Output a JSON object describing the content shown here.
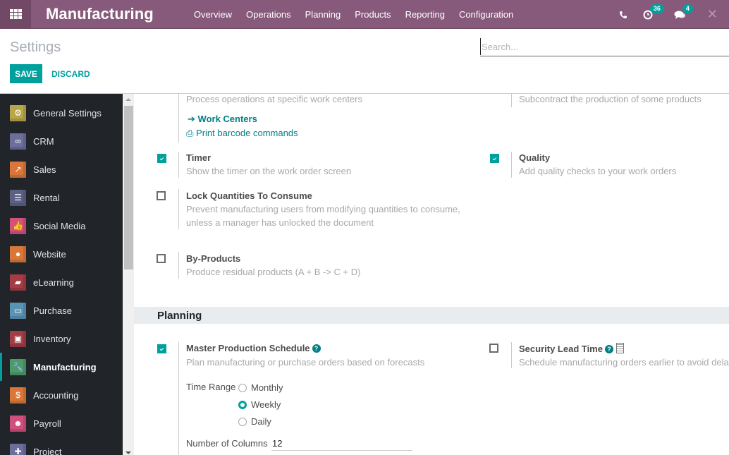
{
  "navbar": {
    "app_title": "Manufacturing",
    "menu": [
      "Overview",
      "Operations",
      "Planning",
      "Products",
      "Reporting",
      "Configuration"
    ],
    "activity_count": "36",
    "message_count": "4"
  },
  "control_panel": {
    "title": "Settings",
    "search_placeholder": "Search...",
    "save_label": "SAVE",
    "discard_label": "DISCARD"
  },
  "sidebar": {
    "active": "Manufacturing",
    "items": [
      {
        "label": "General Settings",
        "icon": "gear-icon",
        "color": "#b8a74a"
      },
      {
        "label": "CRM",
        "icon": "handshake-icon",
        "color": "#6c6e9c"
      },
      {
        "label": "Sales",
        "icon": "chart-icon",
        "color": "#d9773a"
      },
      {
        "label": "Rental",
        "icon": "calendar-icon",
        "color": "#5c6184"
      },
      {
        "label": "Social Media",
        "icon": "thumbs-up-icon",
        "color": "#d2537a"
      },
      {
        "label": "Website",
        "icon": "globe-icon",
        "color": "#d9773a"
      },
      {
        "label": "eLearning",
        "icon": "presentation-icon",
        "color": "#a33c45"
      },
      {
        "label": "Purchase",
        "icon": "credit-card-icon",
        "color": "#5b93b5"
      },
      {
        "label": "Inventory",
        "icon": "box-icon",
        "color": "#a33c45"
      },
      {
        "label": "Manufacturing",
        "icon": "wrench-icon",
        "color": "#4d9a6b"
      },
      {
        "label": "Accounting",
        "icon": "invoice-icon",
        "color": "#d9773a"
      },
      {
        "label": "Payroll",
        "icon": "payroll-icon",
        "color": "#cf4f7d"
      },
      {
        "label": "Project",
        "icon": "puzzle-icon",
        "color": "#6c6e9c"
      }
    ]
  },
  "operations": {
    "workorders_desc": "Process operations at specific work centers",
    "work_centers_link": "Work Centers",
    "print_barcode_link": "Print barcode commands",
    "subcontracting_desc": "Subcontract the production of some products",
    "timer": {
      "title": "Timer",
      "desc": "Show the timer on the work order screen",
      "checked": true
    },
    "quality": {
      "title": "Quality",
      "desc": "Add quality checks to your work orders",
      "checked": true
    },
    "lock_quantities": {
      "title": "Lock Quantities To Consume",
      "desc_line1": "Prevent manufacturing users from modifying quantities to consume,",
      "desc_line2": "unless a manager has unlocked the document",
      "checked": false
    },
    "by_products": {
      "title": "By-Products",
      "desc": "Produce residual products (A + B -> C + D)",
      "checked": false
    }
  },
  "planning": {
    "section_title": "Planning",
    "mps": {
      "title": "Master Production Schedule",
      "desc": "Plan manufacturing or purchase orders based on forecasts",
      "checked": true
    },
    "security_lead_time": {
      "title": "Security Lead Time",
      "desc": "Schedule manufacturing orders earlier to avoid delays",
      "checked": false
    },
    "time_range_label": "Time Range",
    "time_range_options": [
      "Monthly",
      "Weekly",
      "Daily"
    ],
    "time_range_selected": "Weekly",
    "num_columns_label": "Number of Columns",
    "num_columns_value": "12"
  }
}
